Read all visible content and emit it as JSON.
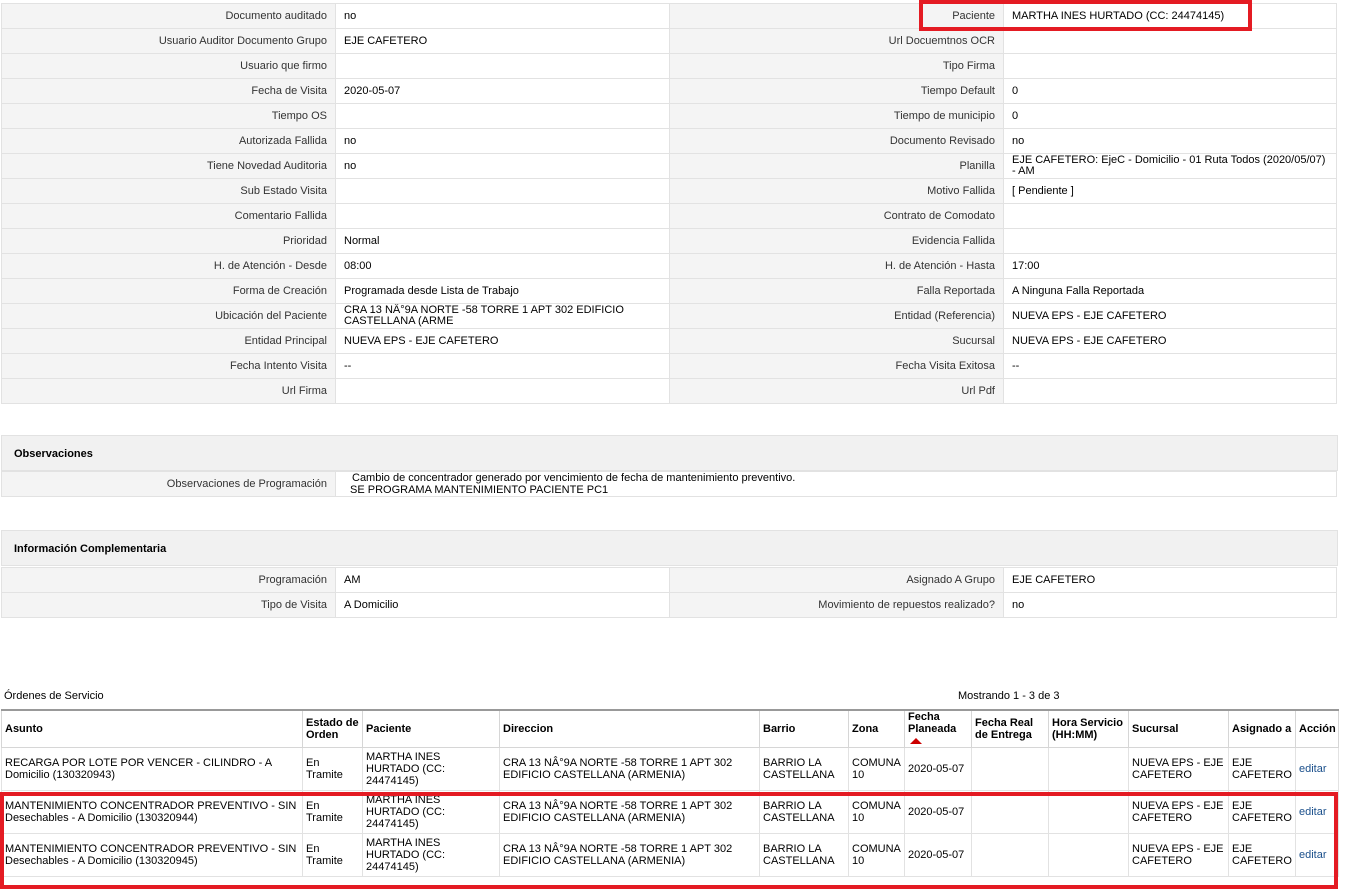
{
  "detail_rows": [
    {
      "l1": "Documento auditado",
      "v1": "no",
      "l2": "Paciente",
      "v2": "MARTHA INES HURTADO (CC: 24474145)"
    },
    {
      "l1": "Usuario Auditor Documento Grupo",
      "v1": "EJE CAFETERO",
      "l2": "Url Docuemtnos OCR",
      "v2": ""
    },
    {
      "l1": "Usuario que firmo",
      "v1": "",
      "l2": "Tipo Firma",
      "v2": ""
    },
    {
      "l1": "Fecha de Visita",
      "v1": "2020-05-07",
      "l2": "Tiempo Default",
      "v2": "0"
    },
    {
      "l1": "Tiempo OS",
      "v1": "",
      "l2": "Tiempo de municipio",
      "v2": "0"
    },
    {
      "l1": "Autorizada Fallida",
      "v1": "no",
      "l2": "Documento Revisado",
      "v2": "no"
    },
    {
      "l1": "Tiene Novedad Auditoria",
      "v1": "no",
      "l2": "Planilla",
      "v2": "EJE CAFETERO: EjeC - Domicilio - 01 Ruta Todos (2020/05/07) - AM"
    },
    {
      "l1": "Sub Estado Visita",
      "v1": "",
      "l2": "Motivo Fallida",
      "v2": "[ Pendiente ]"
    },
    {
      "l1": "Comentario Fallida",
      "v1": "",
      "l2": "Contrato de Comodato",
      "v2": ""
    },
    {
      "l1": "Prioridad",
      "v1": "Normal",
      "l2": "Evidencia Fallida",
      "v2": ""
    },
    {
      "l1": "H. de Atención - Desde",
      "v1": "08:00",
      "l2": "H. de Atención - Hasta",
      "v2": "17:00"
    },
    {
      "l1": "Forma de Creación",
      "v1": "Programada desde Lista de Trabajo",
      "l2": "Falla Reportada",
      "v2": "A Ninguna Falla Reportada"
    },
    {
      "l1": "Ubicación del Paciente",
      "v1": "CRA 13 NÂ°9A NORTE -58 TORRE 1 APT 302 EDIFICIO CASTELLANA (ARME",
      "l2": "Entidad (Referencia)",
      "v2": "NUEVA EPS - EJE CAFETERO"
    },
    {
      "l1": "Entidad Principal",
      "v1": "NUEVA EPS - EJE CAFETERO",
      "l2": "Sucursal",
      "v2": "NUEVA EPS - EJE CAFETERO"
    },
    {
      "l1": "Fecha Intento Visita",
      "v1": "--",
      "l2": "Fecha Visita Exitosa",
      "v2": "--"
    },
    {
      "l1": "Url Firma",
      "v1": "",
      "l2": "Url Pdf",
      "v2": ""
    }
  ],
  "observaciones": {
    "title": "Observaciones",
    "label": "Observaciones de Programación",
    "line1": "Cambio de concentrador generado por vencimiento de fecha de mantenimiento preventivo.",
    "line2": "SE PROGRAMA MANTENIMIENTO PACIENTE PC1"
  },
  "complementaria": {
    "title": "Información Complementaria",
    "rows": [
      {
        "l1": "Programación",
        "v1": "AM",
        "l2": "Asignado A Grupo",
        "v2": "EJE CAFETERO"
      },
      {
        "l1": "Tipo de Visita",
        "v1": "A Domicilio",
        "l2": "Movimiento de repuestos realizado?",
        "v2": "no"
      }
    ]
  },
  "orders": {
    "title": "Órdenes de Servicio",
    "count_text": "Mostrando 1 - 3 de 3",
    "headers": [
      "Asunto",
      "Estado de Orden",
      "Paciente",
      "Direccion",
      "Barrio",
      "Zona",
      "Fecha Planeada",
      "Fecha Real de Entrega",
      "Hora Servicio (HH:MM)",
      "Sucursal",
      "Asignado a",
      "Acción"
    ],
    "rows": [
      {
        "asunto": "RECARGA POR LOTE POR VENCER - CILINDRO - A Domicilio (130320943)",
        "estado": "En Tramite",
        "paciente": "MARTHA INES HURTADO (CC: 24474145)",
        "direccion": "CRA 13 NÂ°9A NORTE -58 TORRE 1 APT 302 EDIFICIO CASTELLANA (ARMENIA)",
        "barrio": "BARRIO LA CASTELLANA",
        "zona": "COMUNA 10",
        "fecha": "2020-05-07",
        "fecha_real": "",
        "hora": "",
        "sucursal": "NUEVA EPS - EJE CAFETERO",
        "asignado": "EJE CAFETERO",
        "accion": "editar"
      },
      {
        "asunto": "MANTENIMIENTO CONCENTRADOR PREVENTIVO - SIN Desechables - A Domicilio (130320944)",
        "estado": "En Tramite",
        "paciente": "MARTHA INES HURTADO (CC: 24474145)",
        "direccion": "CRA 13 NÂ°9A NORTE -58 TORRE 1 APT 302 EDIFICIO CASTELLANA (ARMENIA)",
        "barrio": "BARRIO LA CASTELLANA",
        "zona": "COMUNA 10",
        "fecha": "2020-05-07",
        "fecha_real": "",
        "hora": "",
        "sucursal": "NUEVA EPS - EJE CAFETERO",
        "asignado": "EJE CAFETERO",
        "accion": "editar"
      },
      {
        "asunto": "MANTENIMIENTO CONCENTRADOR PREVENTIVO - SIN Desechables - A Domicilio (130320945)",
        "estado": "En Tramite",
        "paciente": "MARTHA INES HURTADO (CC: 24474145)",
        "direccion": "CRA 13 NÂ°9A NORTE -58 TORRE 1 APT 302 EDIFICIO CASTELLANA (ARMENIA)",
        "barrio": "BARRIO LA CASTELLANA",
        "zona": "COMUNA 10",
        "fecha": "2020-05-07",
        "fecha_real": "",
        "hora": "",
        "sucursal": "NUEVA EPS - EJE CAFETERO",
        "asignado": "EJE CAFETERO",
        "accion": "editar"
      }
    ]
  },
  "colors": {
    "highlight": "#e41b23",
    "link": "#1a4f8b",
    "sort_arrow": "#cc0000"
  }
}
